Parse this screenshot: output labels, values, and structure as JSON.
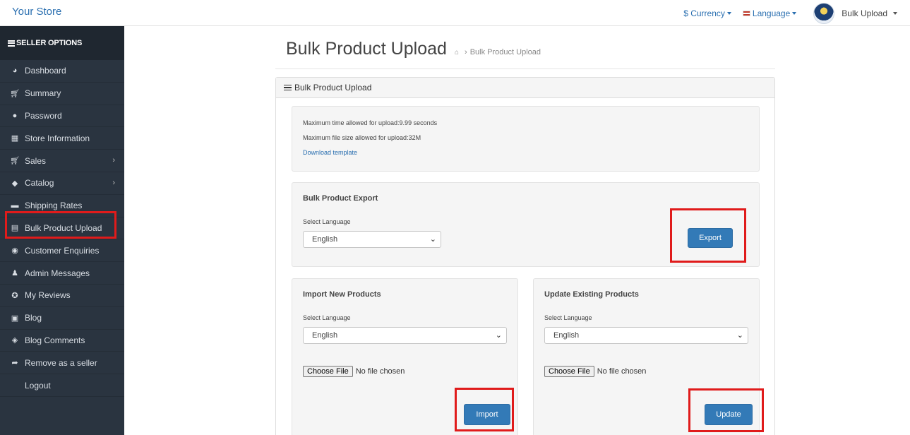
{
  "header": {
    "store_name": "Your Store",
    "currency_label": "$ Currency",
    "language_label": "Language",
    "user_name": "Bulk Upload"
  },
  "sidebar": {
    "heading": "SELLER OPTIONS",
    "items": [
      {
        "label": "Dashboard",
        "icon": "dashboard-icon"
      },
      {
        "label": "Summary",
        "icon": "cart-icon"
      },
      {
        "label": "Password",
        "icon": "user-icon"
      },
      {
        "label": "Store Information",
        "icon": "store-icon"
      },
      {
        "label": "Sales",
        "icon": "cart-icon",
        "has_submenu": true
      },
      {
        "label": "Catalog",
        "icon": "tags-icon",
        "has_submenu": true
      },
      {
        "label": "Shipping Rates",
        "icon": "truck-icon"
      },
      {
        "label": "Bulk Product Upload",
        "icon": "file-upload-icon",
        "selected": true
      },
      {
        "label": "Customer Enquiries",
        "icon": "envelope-icon"
      },
      {
        "label": "Admin Messages",
        "icon": "users-icon"
      },
      {
        "label": "My Reviews",
        "icon": "star-icon"
      },
      {
        "label": "Blog",
        "icon": "blog-icon"
      },
      {
        "label": "Blog Comments",
        "icon": "comments-icon"
      },
      {
        "label": "Remove as a seller",
        "icon": "sign-out-icon"
      },
      {
        "label": "Logout",
        "icon": ""
      }
    ]
  },
  "page": {
    "title": "Bulk Product Upload",
    "breadcrumb_current": "Bulk Product Upload"
  },
  "panel": {
    "heading": "Bulk Product Upload",
    "info": {
      "max_time": "Maximum time allowed for upload:9.99 seconds",
      "max_size": "Maximum file size allowed for upload:32M",
      "download_link": "Download template"
    },
    "export": {
      "title": "Bulk Product Export",
      "language_label": "Select Language",
      "language_value": "English",
      "button": "Export"
    },
    "import": {
      "title": "Import New Products",
      "language_label": "Select Language",
      "language_value": "English",
      "file_button": "Choose File",
      "file_status": "No file chosen",
      "button": "Import"
    },
    "update": {
      "title": "Update Existing Products",
      "language_label": "Select Language",
      "language_value": "English",
      "file_button": "Choose File",
      "file_status": "No file chosen",
      "button": "Update"
    }
  },
  "colors": {
    "sidebar_bg": "#2a3440",
    "primary_button": "#337ab7",
    "highlight": "#e01b1b",
    "link": "#2a6fb0"
  }
}
